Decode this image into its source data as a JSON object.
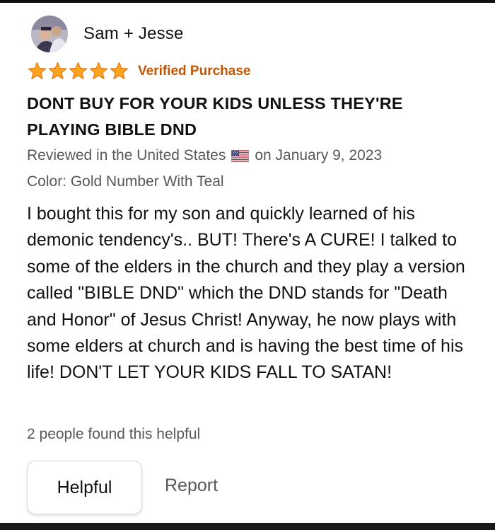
{
  "review": {
    "reviewer_name": "Sam + Jesse",
    "rating": 5,
    "rating_max": 5,
    "star_color": "#ffa41c",
    "verified_label": "Verified Purchase",
    "verified_color": "#c45500",
    "title": "DONT BUY FOR YOUR KIDS UNLESS THEY'RE PLAYING BIBLE DND",
    "reviewed_in": "Reviewed in the United States",
    "flag_icon": "us-flag-icon",
    "reviewed_date": "on January 9, 2023",
    "variant": "Color: Gold Number With Teal",
    "body": "I bought this for my son and quickly learned of his demonic tendency's.. BUT! There's A CURE! I talked to some of the elders in the church and they play a version called \"BIBLE DND\" which the DND stands for \"Death and Honor\" of Jesus Christ! Anyway, he now plays with some elders at church and is having the best time of his life! DON'T LET YOUR KIDS FALL TO SATAN!",
    "helpful_count_text": "2 people found this helpful",
    "helpful_button_label": "Helpful",
    "report_label": "Report"
  }
}
